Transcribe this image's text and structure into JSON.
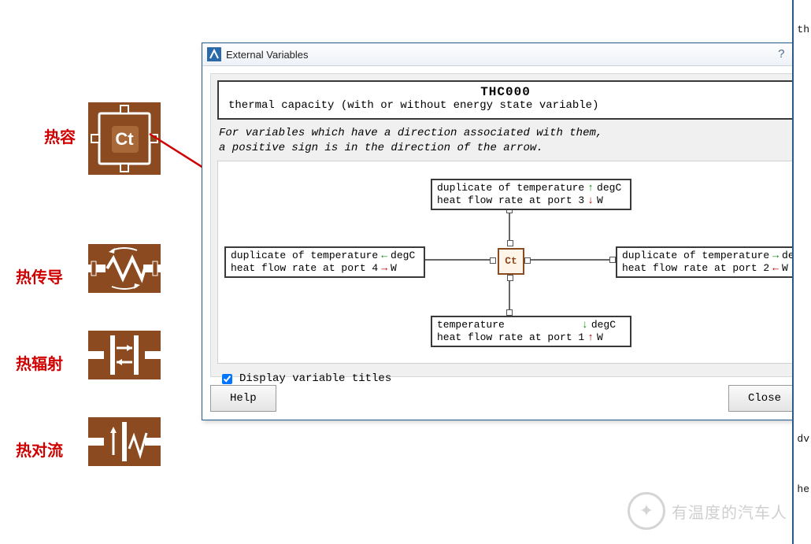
{
  "labels": {
    "cap": "热容",
    "cond": "热传导",
    "rad": "热辐射",
    "conv": "热对流"
  },
  "dialog": {
    "title": "External Variables",
    "model": "THC000",
    "desc": "thermal capacity (with or without energy state variable)",
    "note1": "For variables which have a direction associated with them,",
    "note2": "a positive sign is in the direction of the arrow.",
    "checkbox": "Display variable titles",
    "help": "Help",
    "close": "Close"
  },
  "ports": {
    "top": {
      "l1": "duplicate of temperature",
      "u1": "degC",
      "l2": "heat flow rate at port 3",
      "u2": "W"
    },
    "left": {
      "l1": "duplicate of temperature",
      "u1": "degC",
      "l2": "heat flow rate at port 4",
      "u2": "W"
    },
    "right": {
      "l1": "duplicate of temperature",
      "u1": "degC",
      "l2": "heat flow rate at port 2",
      "u2": "W"
    },
    "bottom": {
      "l1": "temperature",
      "u1": "degC",
      "l2": "heat flow rate at port 1",
      "u2": "W"
    }
  },
  "center": "Ct",
  "icons": {
    "bigct": "Ct"
  },
  "rightbar": {
    "th": "th",
    "dv": "dv",
    "he": "he"
  },
  "watermark": "有温度的汽车人"
}
